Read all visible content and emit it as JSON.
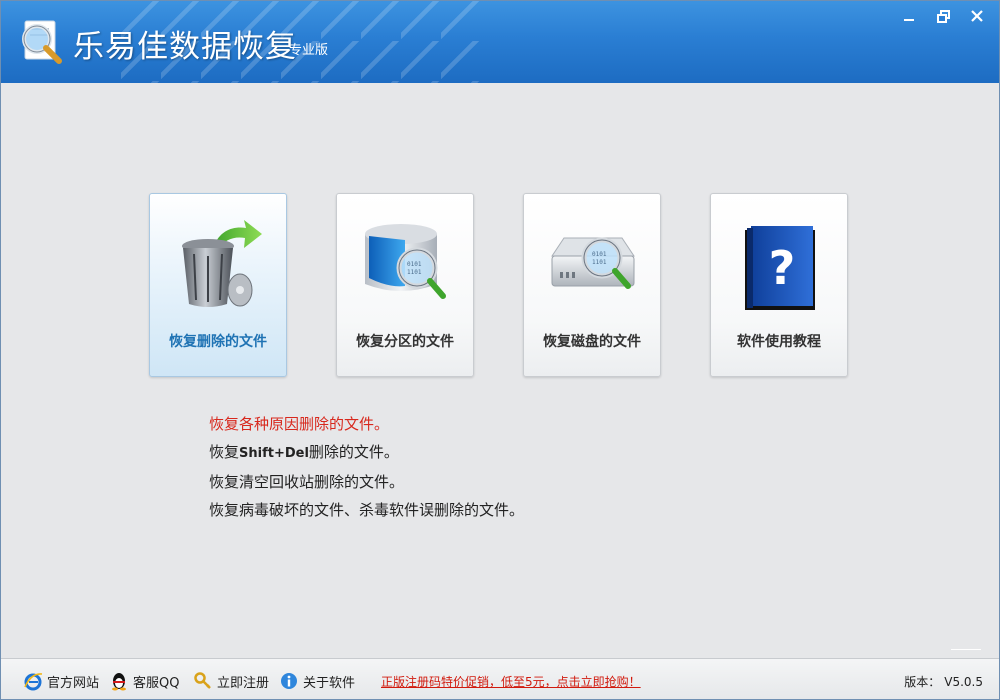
{
  "window": {
    "title": "乐易佳数据恢复",
    "edition": "专业版",
    "controls": {
      "minimize_icon": "minimize-icon",
      "restore_icon": "restore-icon",
      "close_icon": "close-icon"
    }
  },
  "cards": [
    {
      "label": "恢复删除的文件",
      "icon": "recycle-bin-icon",
      "active": true
    },
    {
      "label": "恢复分区的文件",
      "icon": "partition-search-icon",
      "active": false
    },
    {
      "label": "恢复磁盘的文件",
      "icon": "disk-search-icon",
      "active": false
    },
    {
      "label": "软件使用教程",
      "icon": "help-book-icon",
      "active": false
    }
  ],
  "description": {
    "highlight": "恢复各种原因删除的文件。",
    "line2_prefix": "恢复",
    "line2_bold": "Shift+Del",
    "line2_suffix": "删除的文件。",
    "line3": "恢复清空回收站删除的文件。",
    "line4": "恢复病毒破坏的文件、杀毒软件误删除的文件。"
  },
  "statusbar": {
    "links": [
      {
        "label": "官方网站",
        "icon": "ie-icon"
      },
      {
        "label": "客服QQ",
        "icon": "qq-penguin-icon"
      },
      {
        "label": "立即注册",
        "icon": "key-icon"
      },
      {
        "label": "关于软件",
        "icon": "info-icon"
      }
    ],
    "promo": "正版注册码特价促销，低至5元，点击立即抢购！",
    "version_label": "版本：",
    "version_value": "V5.0.5"
  },
  "colors": {
    "titlebar": "#2a7ed3",
    "active_label": "#1f73b4",
    "highlight_text": "#d8281d",
    "promo_text": "#d11a0e"
  }
}
